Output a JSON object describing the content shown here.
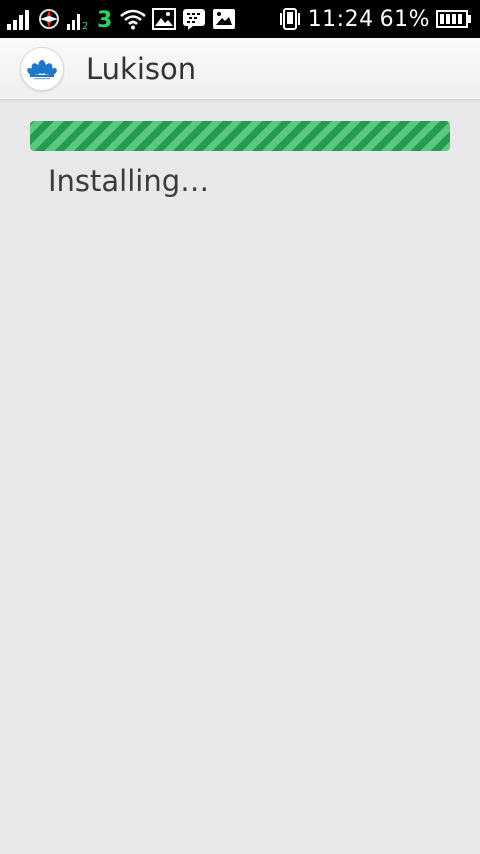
{
  "status_bar": {
    "left_icons": [
      "signal-icon",
      "network-operator-icon",
      "signal-2-icon",
      "three-network-icon",
      "wifi-icon",
      "gallery-notification-icon",
      "bbm-notification-icon",
      "image-notification-icon"
    ],
    "right_icons": [
      "vibrate-icon",
      "battery-icon"
    ],
    "time": "11:24",
    "battery_percent": "61%"
  },
  "app_bar": {
    "title": "Lukison",
    "logo_icon": "lukison-logo-icon"
  },
  "install": {
    "progress_fraction": 1.0,
    "status_text": "Installing…"
  },
  "colors": {
    "background": "#e8e8e8",
    "progress_green": "#2aa55a",
    "progress_stripe": "#5cc77f"
  }
}
